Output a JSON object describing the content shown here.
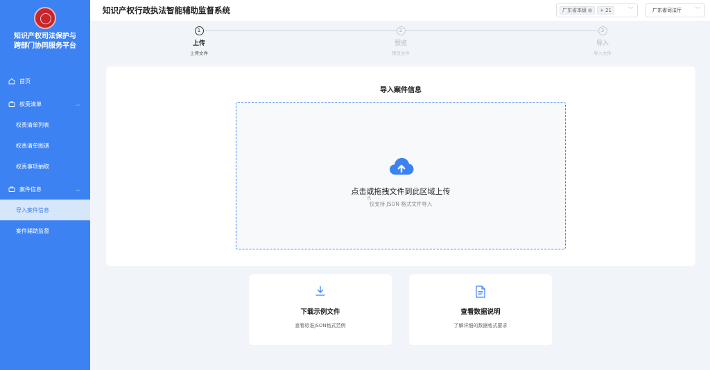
{
  "sidebar": {
    "platform_name_line1": "知识产权司法保护与",
    "platform_name_line2": "跨部门协同服务平台",
    "items": [
      {
        "label": "首页"
      },
      {
        "label": "权责清单"
      },
      {
        "label": "权责清单列表"
      },
      {
        "label": "权责清单图谱"
      },
      {
        "label": "权责事项抽取"
      },
      {
        "label": "案件信息"
      },
      {
        "label": "导入案件信息"
      },
      {
        "label": "案件辅助监督"
      }
    ]
  },
  "header": {
    "title": "知识产权行政执法智能辅助监督系统",
    "region_tag": "广东省本级",
    "region_more": "+ 21",
    "department": "广东省司法厅"
  },
  "steps": [
    {
      "number": "1",
      "title": "上传",
      "desc": "上传文件",
      "state": "active"
    },
    {
      "number": "2",
      "title": "预览",
      "desc": "预览文件",
      "state": "pending"
    },
    {
      "number": "3",
      "title": "导入",
      "desc": "导入文件",
      "state": "pending"
    }
  ],
  "upload": {
    "title": "导入案件信息",
    "main_text": "点击或拖拽文件到此区域上传",
    "sub_text": "仅支持 JSON 格式文件导入"
  },
  "cards": [
    {
      "title": "下载示例文件",
      "desc": "查看标准JSON格式范例",
      "icon": "download-icon"
    },
    {
      "title": "查看数据说明",
      "desc": "了解详细的数据格式要求",
      "icon": "document-icon"
    }
  ],
  "colors": {
    "accent": "#3c82f2",
    "sidebar_bg": "#3c82f2",
    "active_sub_bg": "#d6e6fb",
    "page_bg": "#f1f4f8"
  }
}
